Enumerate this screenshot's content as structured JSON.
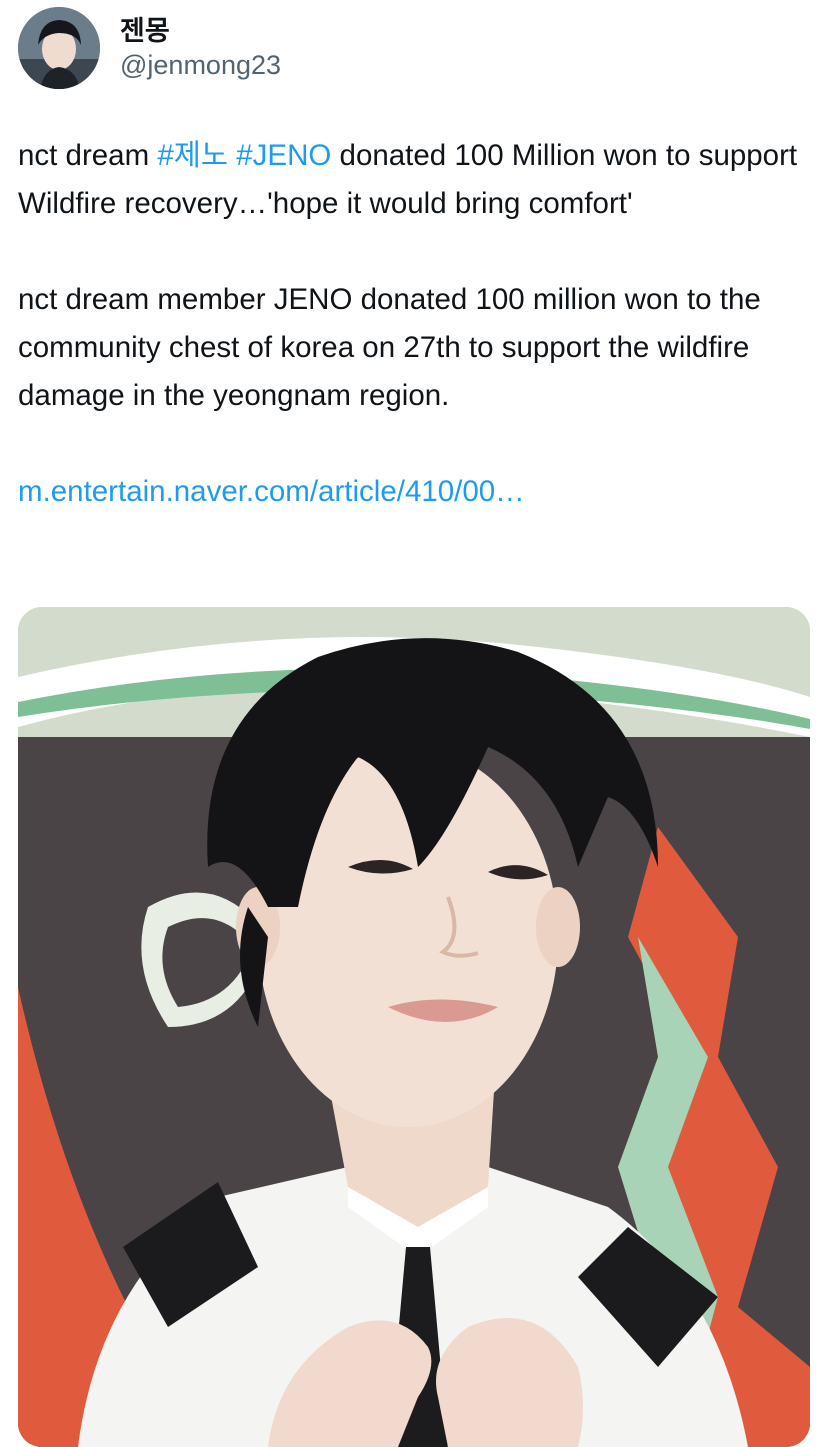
{
  "user": {
    "display_name": "젠몽",
    "handle": "@jenmong23",
    "avatar": "profile-photo"
  },
  "tweet": {
    "p1_prefix": "nct dream ",
    "hashtag_1": "#제노",
    "hashtag_2": "#JENO",
    "p1_suffix": " donated 100 Million won to support Wildfire recovery…'hope it would bring comfort'",
    "p2": "nct dream member JENO donated 100 million won to the community chest of korea on 27th to support the wildfire damage in the yeongnam region.",
    "link": "m.entertain.naver.com/article/410/00…"
  },
  "media": {
    "kind": "photo",
    "subject": "person making heart hands"
  },
  "colors": {
    "link": "#1d9bf0",
    "text": "#0f1419",
    "secondary": "#536471"
  }
}
